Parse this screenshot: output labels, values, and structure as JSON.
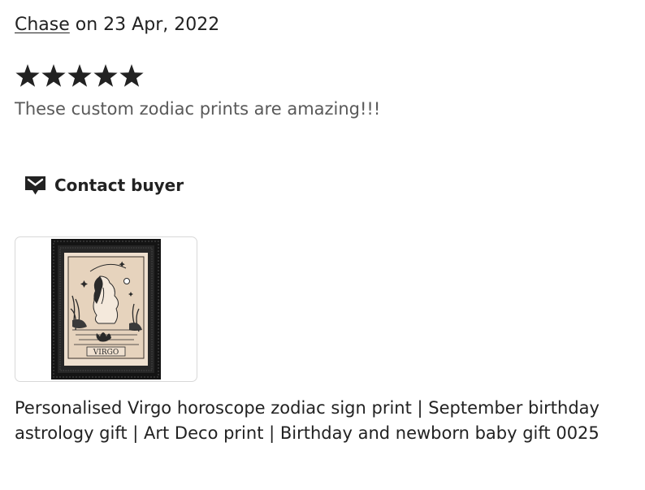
{
  "review": {
    "reviewer_name": "Chase",
    "date_text": " on 23 Apr, 2022",
    "rating": 5,
    "rating_max": 5,
    "text": "These custom zodiac prints are amazing!!!"
  },
  "actions": {
    "contact_label": "Contact buyer",
    "contact_icon": "envelope-icon"
  },
  "product": {
    "image_label": "VIRGO",
    "title_line1": "Personalised Virgo horoscope zodiac sign print | September birthday",
    "title_line2": "astrology gift | Art Deco print | Birthday and newborn baby gift 0025"
  },
  "colors": {
    "text_primary": "#222222",
    "text_secondary": "#595959",
    "card_border": "#d8d8d8",
    "star_color": "#222222"
  }
}
